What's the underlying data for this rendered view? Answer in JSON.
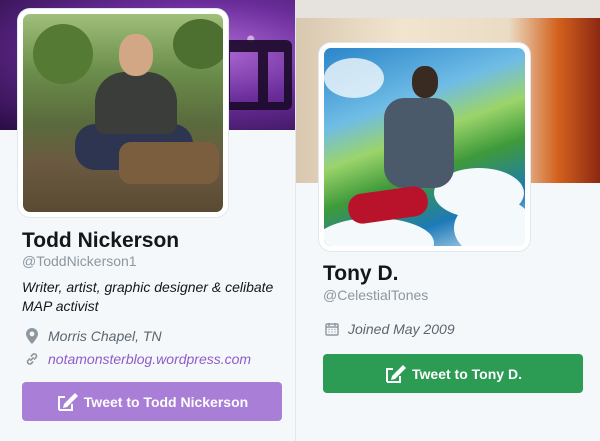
{
  "left_profile": {
    "name": "Todd Nickerson",
    "handle": "@ToddNickerson1",
    "bio": "Writer, artist, graphic designer & celibate MAP activist",
    "location": "Morris Chapel, TN",
    "website": "notamonsterblog.wordpress.com",
    "tweet_button_label": "Tweet to Todd Nickerson",
    "accent_color": "#a87ed6",
    "icons": {
      "location": "location-pin-icon",
      "website": "link-icon",
      "tweet": "compose-tweet-icon"
    }
  },
  "right_profile": {
    "name": "Tony D.",
    "handle": "@CelestialTones",
    "joined": "Joined May 2009",
    "tweet_button_label": "Tweet to Tony D.",
    "accent_color": "#2c9b53",
    "icons": {
      "joined": "calendar-icon",
      "tweet": "compose-tweet-icon"
    }
  }
}
